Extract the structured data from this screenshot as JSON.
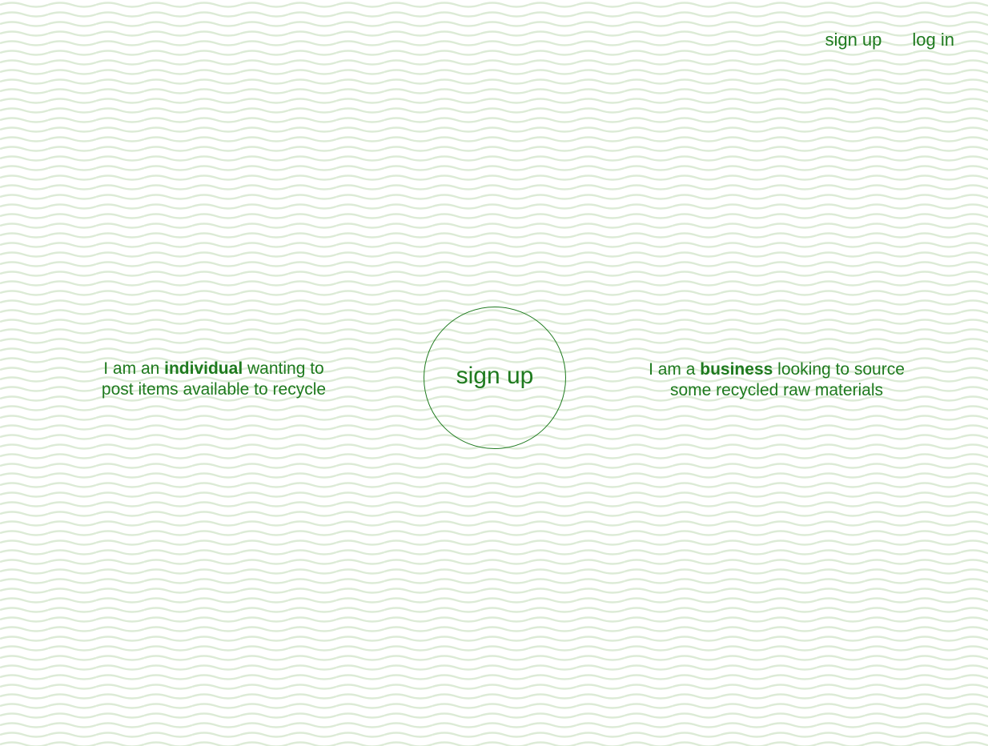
{
  "nav": {
    "signup_label": "sign up",
    "login_label": "log in"
  },
  "choices": {
    "individual": {
      "prefix": "I am an ",
      "emphasis": "individual",
      "suffix_line1": " wanting to",
      "line2": "post items available to recycle"
    },
    "business": {
      "prefix": "I am a ",
      "emphasis": "business",
      "suffix_line1": " looking to source",
      "line2": "some recycled raw materials"
    }
  },
  "center_button": {
    "label": "sign up"
  },
  "colors": {
    "accent": "#1e7a1e",
    "wave": "#dcebd6",
    "background": "#ffffff"
  },
  "icons": {
    "background": "wave-pattern"
  }
}
